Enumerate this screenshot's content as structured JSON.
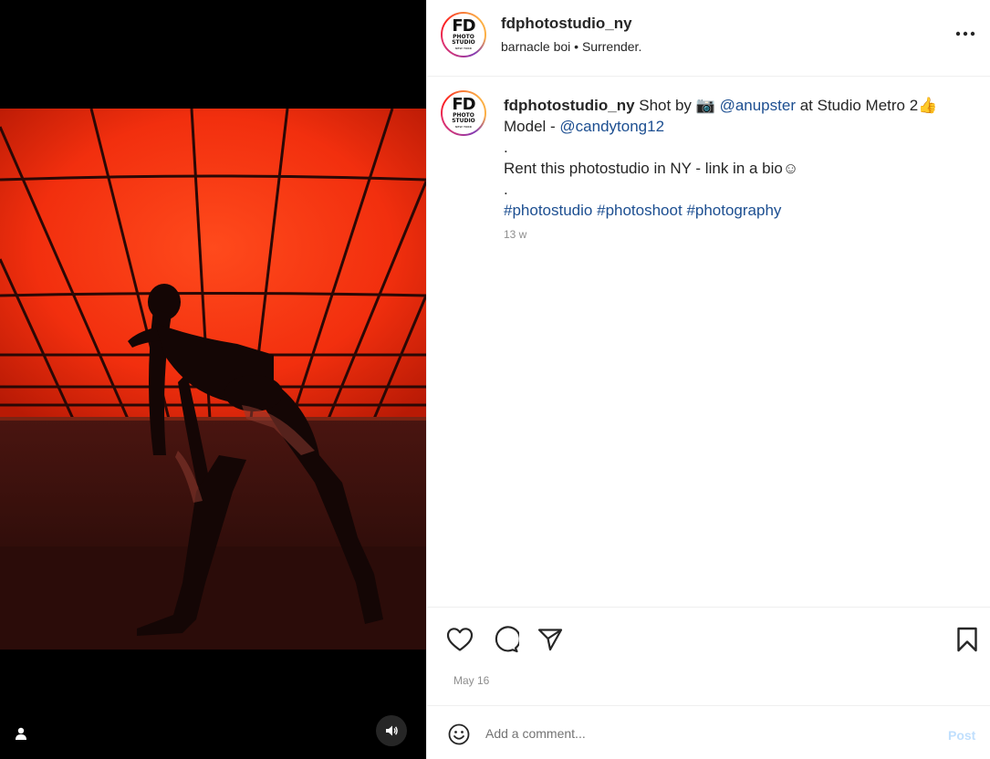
{
  "post": {
    "username": "fdphotostudio_ny",
    "audio_artist": "barnacle boi",
    "audio_separator": "•",
    "audio_track": "Surrender.",
    "more_icon": "more-horizontal-icon",
    "avatar_logo": {
      "main": "FD",
      "line1": "PHOTO",
      "line2": "STUDIO",
      "line3": "NEW YORK"
    }
  },
  "caption": {
    "username": "fdphotostudio_ny",
    "text_shot_by": "Shot by",
    "camera_emoji": "📷",
    "photographer": "@anupster",
    "text_at": "at Studio Metro 2",
    "thumbs_emoji": "👍",
    "model_label": "Model -",
    "model_handle": "@candytong12",
    "dot1": ".",
    "rent_text": "Rent this photostudio in NY - link in a bio",
    "smile_emoji": "☺",
    "dot2": ".",
    "hashtags": [
      "#photostudio",
      "#photoshoot",
      "#photography"
    ],
    "time_ago": "13 w"
  },
  "actions": {
    "like_icon": "heart-icon",
    "comment_icon": "comment-icon",
    "share_icon": "share-icon",
    "save_icon": "bookmark-icon",
    "date": "May 16"
  },
  "comment_box": {
    "placeholder": "Add a comment...",
    "post_label": "Post",
    "emoji_icon": "emoji-icon"
  },
  "media": {
    "tag_icon": "user-tag-icon",
    "sound_icon": "volume-icon"
  },
  "colors": {
    "link": "#1d4f91",
    "muted": "#8e8e8e",
    "post_disabled": "#c0dffd",
    "light_panel": "#ff3d1a"
  }
}
